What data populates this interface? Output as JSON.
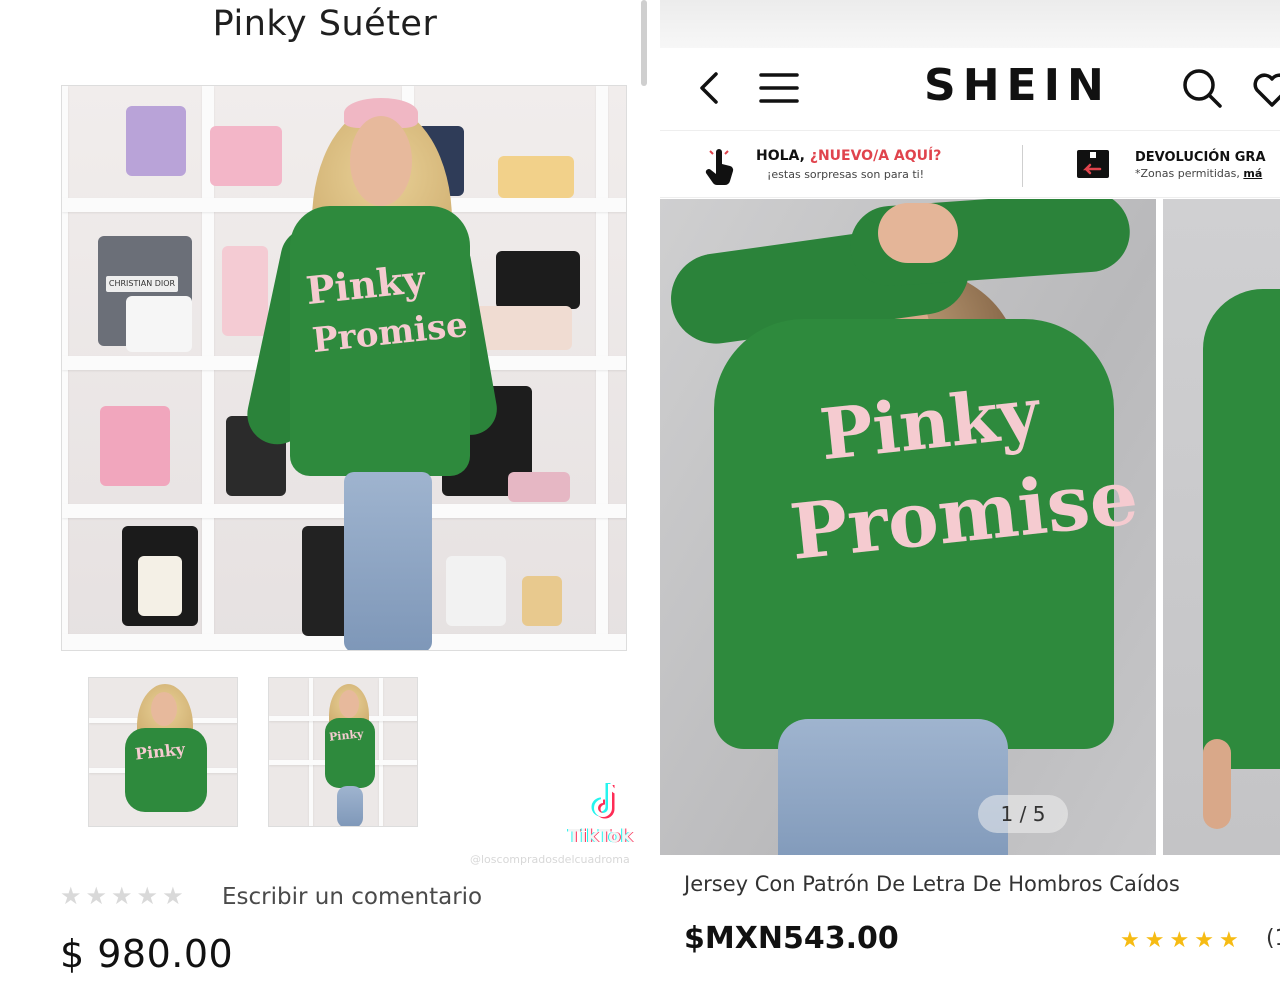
{
  "left": {
    "title": "Pinky Suéter",
    "tiktok_label": "TikTok",
    "watermark": "@loscompradosdelcuadroma",
    "rating_stars": 5,
    "comment_link": "Escribir un comentario",
    "price": "$ 980.00",
    "sweater_text_line1": "Pinky",
    "sweater_text_line2": "Promise",
    "shelf_bag_label": "CHRISTIAN DIOR",
    "icons": [
      "tiktok-icon",
      "star-icon"
    ]
  },
  "right": {
    "brand": "SHEIN",
    "nav_icons": [
      "back-arrow-icon",
      "menu-icon",
      "search-icon",
      "heart-icon"
    ],
    "promo": {
      "title_prefix": "HOLA, ",
      "title_accent": "¿NUEVO/A AQUÍ?",
      "subtitle": "¡estas sorpresas son para ti!"
    },
    "returns": {
      "title": "DEVOLUCIÓN GRA",
      "subtitle": "*Zonas permitidas, ",
      "link": "má"
    },
    "gallery": {
      "counter": "1 / 5",
      "sweater_text_line1": "Pinky",
      "sweater_text_line2": "Promise"
    },
    "product_name": "Jersey Con Patrón De Letra De Hombros Caídos",
    "price": "$MXN543.00",
    "rating_stars": 5,
    "rating_count": "(1"
  },
  "colors": {
    "sweater_green": "#2e8a3d",
    "lettering_pink": "#f5cbd0",
    "promo_accent": "#e0444d",
    "star_gold": "#f6bb13",
    "star_empty": "#d9d9d9"
  }
}
